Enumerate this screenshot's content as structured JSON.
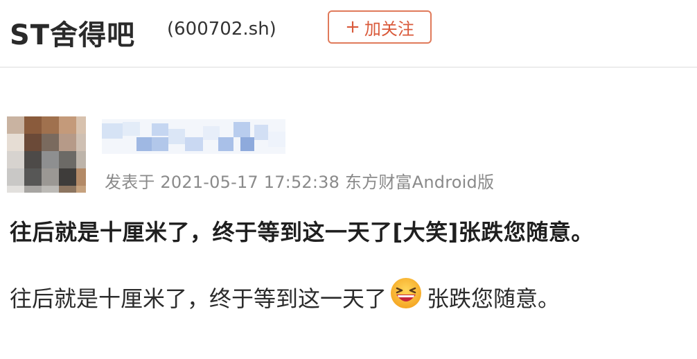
{
  "header": {
    "forum_title": "ST舍得吧",
    "stock_code": "(600702.sh)",
    "follow_button": {
      "icon": "plus-icon",
      "plus": "+",
      "label": "加关注"
    }
  },
  "post": {
    "author_avatar": "pixelated-avatar",
    "author_name": "",
    "meta": "发表于 2021-05-17 17:52:38 东方财富Android版",
    "raw_text": "往后就是十厘米了，终于等到这一天了[大笑]张跌您随意。",
    "rendered_text_before_emoji": "往后就是十厘米了，终于等到这一天了",
    "emoji": "laughing-face-emoji",
    "rendered_text_after_emoji": "张跌您随意。"
  },
  "colors": {
    "follow_accent": "#d9593a",
    "meta_gray": "#8a8a8a",
    "divider": "#ececec"
  }
}
